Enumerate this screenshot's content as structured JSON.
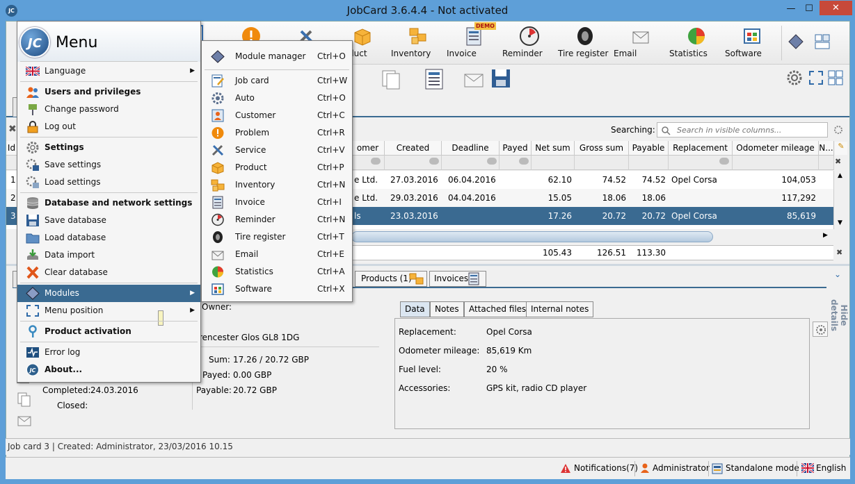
{
  "window": {
    "title": "JobCard 3.6.4.4 - Not activated",
    "min": "—",
    "max": "☐",
    "close": "✕",
    "app_icon_text": "JC"
  },
  "toolbar": {
    "items": [
      {
        "label": "Product"
      },
      {
        "label": "Inventory"
      },
      {
        "label": "Invoice",
        "badge": "DEMO"
      },
      {
        "label": "Reminder"
      },
      {
        "label": "Tire register"
      },
      {
        "label": "Email"
      },
      {
        "label": "Statistics"
      },
      {
        "label": "Software"
      }
    ]
  },
  "search": {
    "label": "Searching:",
    "placeholder": "Search in visible columns..."
  },
  "grid": {
    "columns": [
      "Id",
      "omer",
      "Created",
      "Deadline",
      "Payed",
      "Net sum",
      "Gross sum",
      "Payable",
      "Replacement",
      "Odometer mileage",
      "N..."
    ],
    "rows": [
      {
        "id": "1",
        "customer": "e Ltd.",
        "created": "27.03.2016",
        "deadline": "06.04.2016",
        "net": "62.10",
        "gross": "74.52",
        "payable": "74.52",
        "replacement": "Opel Corsa",
        "odometer": "104,053"
      },
      {
        "id": "2",
        "customer": "e Ltd.",
        "created": "29.03.2016",
        "deadline": "04.04.2016",
        "net": "15.05",
        "gross": "18.06",
        "payable": "18.06",
        "replacement": "",
        "odometer": "117,292"
      },
      {
        "id": "3",
        "customer": "ls",
        "created": "23.03.2016",
        "deadline": "",
        "net": "17.26",
        "gross": "20.72",
        "payable": "20.72",
        "replacement": "Opel Corsa",
        "odometer": "85,619"
      }
    ],
    "totals": {
      "net": "105.43",
      "gross": "126.51",
      "payable": "113.30"
    }
  },
  "detail_tabs": [
    {
      "label": "Products (1)"
    },
    {
      "label": "Invoices"
    }
  ],
  "hide_details": "Hide details",
  "info": {
    "owner_label": "Owner:",
    "address": "rencester Glos GL8 1DG",
    "sum_label": "Sum:",
    "sum_value": "17.26 / 20.72 GBP",
    "payed_label": "Payed:",
    "payed_value": "0.00 GBP",
    "payable_label": "Payable:",
    "payable_value": "20.72 GBP",
    "completed_label": "Completed:",
    "completed_value": "24.03.2016",
    "closed_label": "Closed:"
  },
  "data_tabs": [
    {
      "label": "Data"
    },
    {
      "label": "Notes"
    },
    {
      "label": "Attached files"
    },
    {
      "label": "Internal notes"
    }
  ],
  "data_fields": [
    {
      "label": "Replacement:",
      "value": "Opel Corsa"
    },
    {
      "label": "Odometer mileage:",
      "value": "85,619 Km"
    },
    {
      "label": "Fuel level:",
      "value": "20 %"
    },
    {
      "label": "Accessories:",
      "value": "GPS kit, radio CD player"
    }
  ],
  "status1": "Job card 3 | Created: Administrator, 23/03/2016 10.15",
  "status2": {
    "notifications": "Notifications(7)",
    "user": "Administrator",
    "mode": "Standalone mode",
    "language": "English"
  },
  "menu": {
    "title": "Menu",
    "logo": "JC",
    "items": [
      {
        "label": "Language"
      },
      {
        "label": "Users and privileges"
      },
      {
        "label": "Change password"
      },
      {
        "label": "Log out"
      },
      {
        "label": "Settings"
      },
      {
        "label": "Save settings"
      },
      {
        "label": "Load settings"
      },
      {
        "label": "Database and network settings"
      },
      {
        "label": "Save database"
      },
      {
        "label": "Load database"
      },
      {
        "label": "Data import"
      },
      {
        "label": "Clear database"
      },
      {
        "label": "Modules"
      },
      {
        "label": "Menu position"
      },
      {
        "label": "Product activation"
      },
      {
        "label": "Error log"
      },
      {
        "label": "About..."
      }
    ]
  },
  "submenu": {
    "items": [
      {
        "label": "Module manager",
        "shortcut": "Ctrl+O"
      },
      {
        "label": "Job card",
        "shortcut": "Ctrl+W"
      },
      {
        "label": "Auto",
        "shortcut": "Ctrl+O"
      },
      {
        "label": "Customer",
        "shortcut": "Ctrl+C"
      },
      {
        "label": "Problem",
        "shortcut": "Ctrl+R"
      },
      {
        "label": "Service",
        "shortcut": "Ctrl+V"
      },
      {
        "label": "Product",
        "shortcut": "Ctrl+P"
      },
      {
        "label": "Inventory",
        "shortcut": "Ctrl+N"
      },
      {
        "label": "Invoice",
        "shortcut": "Ctrl+I"
      },
      {
        "label": "Reminder",
        "shortcut": "Ctrl+N"
      },
      {
        "label": "Tire register",
        "shortcut": "Ctrl+T"
      },
      {
        "label": "Email",
        "shortcut": "Ctrl+E"
      },
      {
        "label": "Statistics",
        "shortcut": "Ctrl+A"
      },
      {
        "label": "Software",
        "shortcut": "Ctrl+X"
      }
    ]
  },
  "colors": {
    "accent": "#3a6a91",
    "titlebar": "#5e9fd8",
    "close": "#c7493a"
  }
}
